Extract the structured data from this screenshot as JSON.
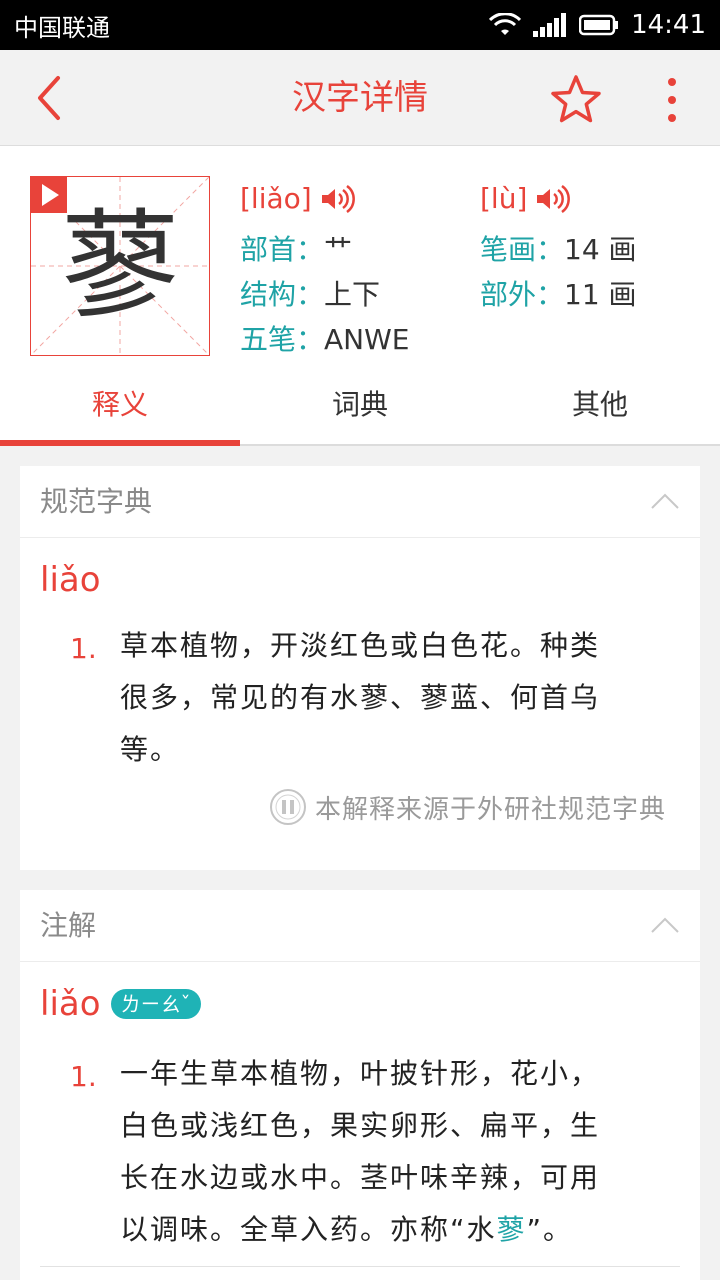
{
  "status": {
    "carrier": "中国联通",
    "time": "14:41"
  },
  "appbar": {
    "title": "汉字详情"
  },
  "character": {
    "glyph": "蓼",
    "pinyin1": "[liǎo]",
    "pinyin2": "[lù]",
    "radical_label": "部首：",
    "radical_value": "艹",
    "strokes_label": "笔画：",
    "strokes_value": "14 画",
    "structure_label": "结构：",
    "structure_value": "上下",
    "outside_label": "部外：",
    "outside_value": "11 画",
    "wubi_label": "五笔：",
    "wubi_value": "ANWE"
  },
  "tabs": [
    "释义",
    "词典",
    "其他"
  ],
  "card1": {
    "title": "规范字典",
    "pinyin": "liǎo",
    "def_num": "1.",
    "def_line1": "草本植物，开淡红色或白色花。种类",
    "def_line2": "很多，常见的有水蓼、蓼蓝、何首乌",
    "def_line3": "等。",
    "source": "本解释来源于外研社规范字典"
  },
  "card2": {
    "title": "注解",
    "pinyin": "liǎo",
    "zhuyin": "ㄌㄧㄠˇ",
    "def_num": "1.",
    "def_line1": "一年生草本植物，叶披针形，花小，",
    "def_line2": "白色或浅红色，果实卵形、扁平，生",
    "def_line3": "长在水边或水中。茎叶味辛辣，可用",
    "def_line4_pre": "以调味。全草入药。亦称“水",
    "def_line4_hl": "蓼",
    "def_line4_post": "”。"
  },
  "colors": {
    "accent": "#e8433a",
    "teal": "#1fa3a6"
  }
}
